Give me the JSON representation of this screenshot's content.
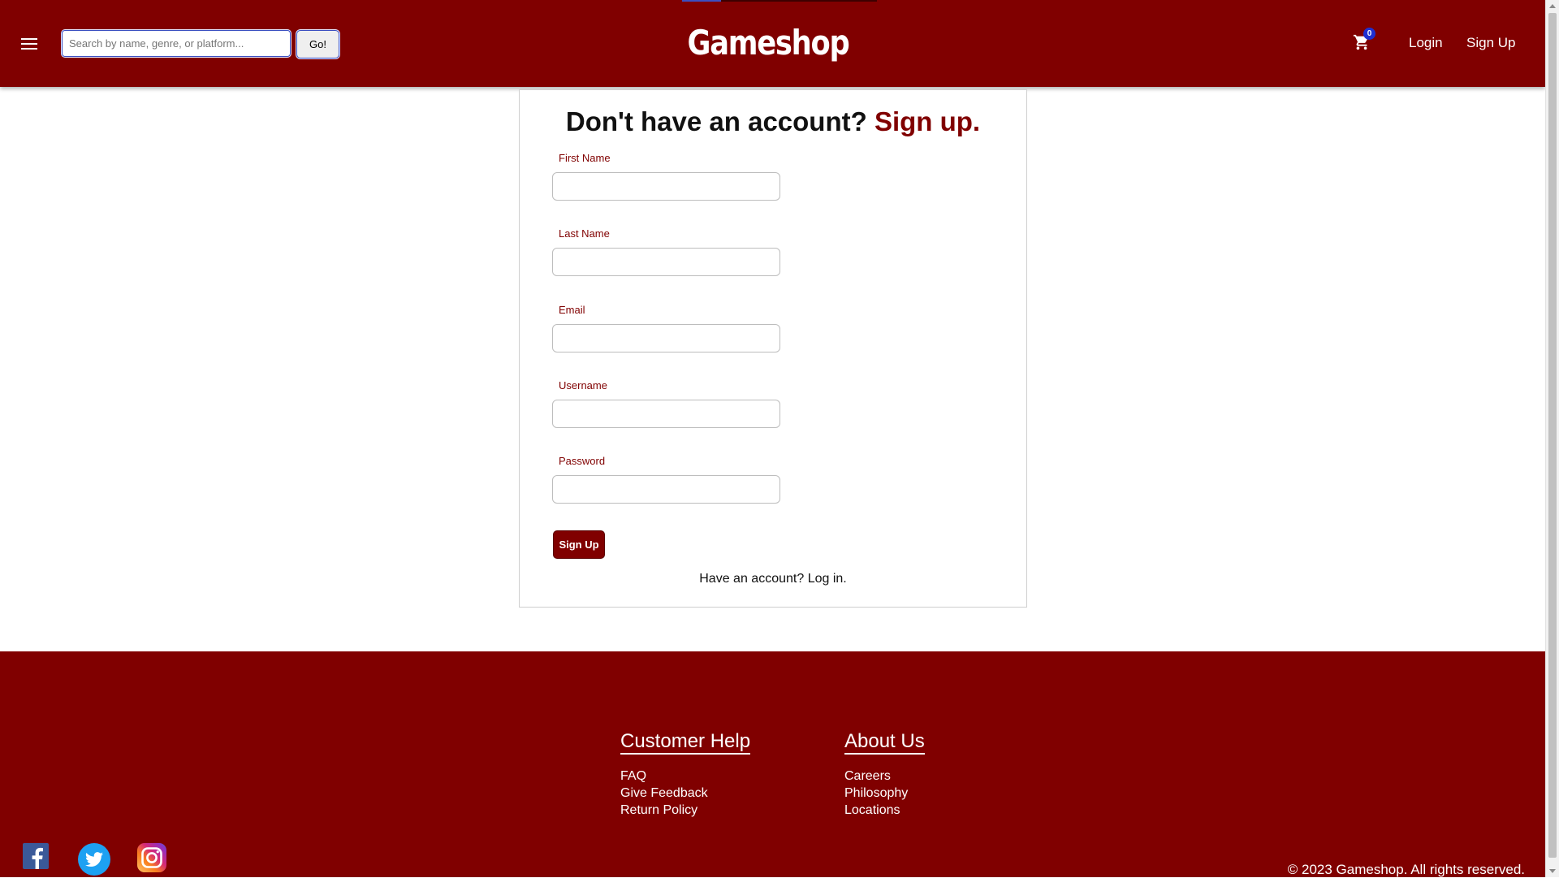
{
  "header": {
    "search_placeholder": "Search by name, genre, or platform...",
    "go_label": "Go!",
    "logo": "Gameshop",
    "cart_count": "0",
    "login_label": "Login",
    "signup_label": "Sign Up"
  },
  "form": {
    "title": "Don't have an account?",
    "title_accent": "Sign up.",
    "fields": [
      {
        "label": "First Name",
        "value": ""
      },
      {
        "label": "Last Name",
        "value": ""
      },
      {
        "label": "Email",
        "value": ""
      },
      {
        "label": "Username",
        "value": ""
      },
      {
        "label": "Password",
        "value": ""
      }
    ],
    "submit_label": "Sign Up",
    "login_prompt": "Have an account?",
    "login_link": "Log in",
    "login_period": "."
  },
  "footer": {
    "customer_help": {
      "heading": "Customer Help",
      "links": [
        "FAQ",
        "Give Feedback",
        "Return Policy"
      ]
    },
    "about_us": {
      "heading": "About Us",
      "links": [
        "Careers",
        "Philosophy",
        "Locations"
      ]
    },
    "social_icons": [
      "facebook-icon",
      "twitter-icon",
      "instagram-icon"
    ],
    "copyright": "© 2023 Gameshop. All rights reserved."
  },
  "colors": {
    "brand": "#800000",
    "badge": "#1f2fd1",
    "focus": "#3b50c2"
  }
}
